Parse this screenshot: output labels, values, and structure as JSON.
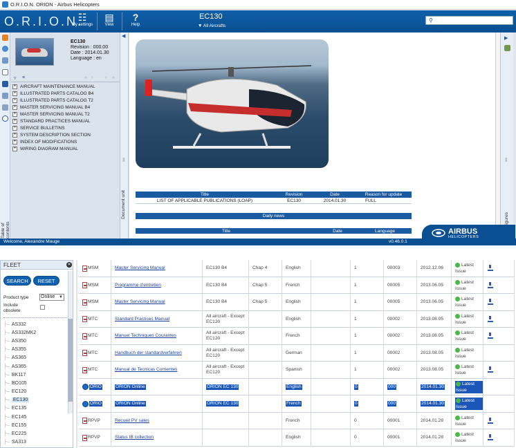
{
  "window": {
    "title": "O.R.I.O.N. ORION - Airbus Helicopters"
  },
  "toolbar": {
    "logo": "O.R.I.O.N.",
    "my_settings": "My settings",
    "view": "View",
    "help": "Help",
    "title": "EC130",
    "subtitle": "All Aircrafts"
  },
  "aircraft": {
    "name": "EC130",
    "revision": "Revision : 000.00",
    "date": "Date : 2014.01.30",
    "language": "Language : en"
  },
  "left_rail": {
    "toc_label": "Table of contents"
  },
  "manuals": [
    "AIRCRAFT MAINTENANCE MANUAL",
    "ILLUSTRATED PARTS CATALOG B4",
    "ILLUSTRATED PARTS CATALOG T2",
    "MASTER SERVICING MANUAL B4",
    "MASTER SERVICING MANUAL T2",
    "STANDARD PRACTICES MANUAL",
    "SERVICE BULLETINS",
    "SYSTEM DESCRIPTION SECTION",
    "INDEX OF MODIFICATIONS",
    "WIRING DIAGRAM MANUAL"
  ],
  "doc_label": "Document unit",
  "figures_label": "Figures",
  "loap": {
    "headers": [
      "Title",
      "Revision",
      "Date",
      "Reason for update"
    ],
    "row": [
      "LIST OF APPLICABLE PUBLICATIONS (LOAP)",
      "EC130",
      "2014.01.30",
      "FULL"
    ]
  },
  "news": {
    "title": "Daily news",
    "cols": [
      "Title",
      "Date",
      "Language"
    ]
  },
  "brand": {
    "name": "AIRBUS",
    "sub": "HELICOPTERS"
  },
  "status": {
    "welcome": "Welcome, Alexandre Mauge",
    "version": "v0.46.0.1"
  },
  "fleet": {
    "title": "FLEET",
    "search": "SEARCH",
    "reset": "RESET",
    "product_type_label": "Product type",
    "product_type_value": "Online",
    "include_obsolete": "Include obsolete",
    "items": [
      "AS332",
      "AS332MK2",
      "AS350",
      "AS355",
      "AS365",
      "AS365",
      "BK117",
      "BO105",
      "EC120",
      "EC130",
      "EC135",
      "EC145",
      "EC155",
      "EC225",
      "SA313"
    ],
    "selected": "EC130"
  },
  "grid": {
    "rows": [
      {
        "type": "MSM",
        "icon": "pdf",
        "title": "Master Servicing Manual",
        "model": "EC130 B4",
        "chap": "Chap 4",
        "lang": "English",
        "num": "1",
        "code": "00003",
        "date": "2012.12.06",
        "status": "Latest Issue",
        "download": true,
        "selected": false
      },
      {
        "type": "MSM",
        "icon": "pdf",
        "title": "Programme d'entretien",
        "model": "EC130 B4",
        "chap": "Chap 5",
        "lang": "French",
        "num": "1",
        "code": "00005",
        "date": "2013.06.05",
        "status": "Latest Issue",
        "download": true,
        "selected": false
      },
      {
        "type": "MSM",
        "icon": "pdf",
        "title": "Master Servicing Manual",
        "model": "EC130 B4",
        "chap": "Chap 5",
        "lang": "English",
        "num": "1",
        "code": "00005",
        "date": "2013.06.05",
        "status": "Latest Issue",
        "download": true,
        "selected": false
      },
      {
        "type": "MTC",
        "icon": "pdf",
        "title": "Standard Practices Manual",
        "model": "All aircraft - Except EC120",
        "chap": "",
        "lang": "English",
        "num": "1",
        "code": "00002",
        "date": "2013.08.05",
        "status": "Latest Issue",
        "download": true,
        "selected": false
      },
      {
        "type": "MTC",
        "icon": "pdf",
        "title": "Manuel Techniques Courantes",
        "model": "All aircraft - Except EC120",
        "chap": "",
        "lang": "French",
        "num": "1",
        "code": "00002",
        "date": "2013.08.05",
        "status": "Latest Issue",
        "download": true,
        "selected": false
      },
      {
        "type": "MTC",
        "icon": "pdf",
        "title": "Handbuch der standardverfahren",
        "model": "All aircraft - Except EC120",
        "chap": "",
        "lang": "German",
        "num": "1",
        "code": "00002",
        "date": "2013.08.05",
        "status": "Latest Issue",
        "download": false,
        "selected": false
      },
      {
        "type": "MTC",
        "icon": "pdf",
        "title": "Manual de Tecnicas Corrientes",
        "model": "All aircraft - Except EC120",
        "chap": "",
        "lang": "Spanish",
        "num": "1",
        "code": "00002",
        "date": "2013.08.05",
        "status": "Latest Issue",
        "download": true,
        "selected": false
      },
      {
        "type": "ORIO",
        "icon": "orion",
        "title": "ORION Online",
        "model": "ORION EC 130",
        "chap": "",
        "lang": "English",
        "num": "0",
        "code": "000",
        "date": "2014.01.30",
        "status": "Latest Issue",
        "download": false,
        "selected": true
      },
      {
        "type": "ORIO",
        "icon": "orion",
        "title": "ORION Online",
        "model": "ORION EC 130",
        "chap": "",
        "lang": "French",
        "num": "0",
        "code": "000",
        "date": "2014.01.30",
        "status": "Latest Issue",
        "download": false,
        "selected": true
      },
      {
        "type": "RPVP",
        "icon": "pdf",
        "title": "Recueil PV sales",
        "model": "",
        "chap": "",
        "lang": "French",
        "num": "0",
        "code": "00001",
        "date": "2014.01.28",
        "status": "Latest Issue",
        "download": true,
        "selected": false
      },
      {
        "type": "RPVP",
        "icon": "pdf",
        "title": "Status IB collection",
        "model": "",
        "chap": "",
        "lang": "English",
        "num": "0",
        "code": "00001",
        "date": "2014.01.28",
        "status": "Latest Issue",
        "download": true,
        "selected": false
      }
    ]
  },
  "colors": {
    "brand_blue": "#0a4f91",
    "header_blue": "#1a5aa0",
    "selection": "#1a57b8",
    "status_green": "#4cb848"
  }
}
